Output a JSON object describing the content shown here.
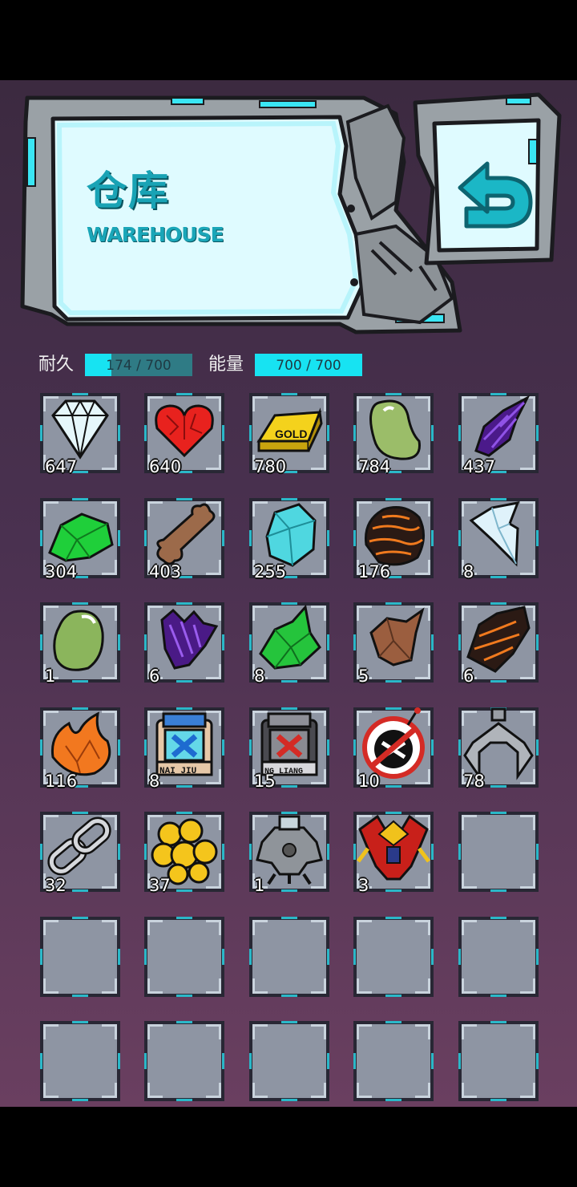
{
  "header": {
    "title_cn": "仓库",
    "title_en": "WAREHOUSE"
  },
  "stats": {
    "durability": {
      "label": "耐久",
      "text": "174 / 700",
      "current": 174,
      "max": 700
    },
    "energy": {
      "label": "能量",
      "text": "700 / 700",
      "current": 700,
      "max": 700
    }
  },
  "colors": {
    "panel_cyan": "#dffbff",
    "bar_fill": "#17e3f2",
    "bar_bg": "#2f7b85",
    "title": "#19a3b5"
  },
  "items": [
    {
      "icon": "diamond-icon",
      "count": "647"
    },
    {
      "icon": "red-heart-crystal-icon",
      "count": "640"
    },
    {
      "icon": "gold-bar-icon",
      "count": "780",
      "text": "GOLD"
    },
    {
      "icon": "green-bean-icon",
      "count": "784"
    },
    {
      "icon": "purple-crystal-shard-icon",
      "count": "437"
    },
    {
      "icon": "green-crystal-icon",
      "count": "304"
    },
    {
      "icon": "bone-icon",
      "count": "403"
    },
    {
      "icon": "cyan-crystal-icon",
      "count": "255"
    },
    {
      "icon": "lava-rock-icon",
      "count": "176"
    },
    {
      "icon": "ice-shard-icon",
      "count": "8"
    },
    {
      "icon": "green-blob-icon",
      "count": "1"
    },
    {
      "icon": "purple-spiky-crystal-icon",
      "count": "6"
    },
    {
      "icon": "green-gem-icon",
      "count": "8"
    },
    {
      "icon": "brown-rock-icon",
      "count": "5"
    },
    {
      "icon": "lava-shard-icon",
      "count": "6"
    },
    {
      "icon": "orange-flame-crystal-icon",
      "count": "116"
    },
    {
      "icon": "durability-canister-icon",
      "count": "8",
      "text": "NAI JIU"
    },
    {
      "icon": "energy-canister-icon",
      "count": "15",
      "text": "NG LIANG"
    },
    {
      "icon": "no-bomb-icon",
      "count": "10"
    },
    {
      "icon": "claw-icon",
      "count": "78"
    },
    {
      "icon": "chain-link-icon",
      "count": "32"
    },
    {
      "icon": "gold-coins-icon",
      "count": "37"
    },
    {
      "icon": "gray-mech-icon",
      "count": "1"
    },
    {
      "icon": "red-mech-icon",
      "count": "3"
    },
    {
      "icon": "",
      "count": ""
    },
    {
      "icon": "",
      "count": ""
    },
    {
      "icon": "",
      "count": ""
    },
    {
      "icon": "",
      "count": ""
    },
    {
      "icon": "",
      "count": ""
    },
    {
      "icon": "",
      "count": ""
    },
    {
      "icon": "",
      "count": ""
    },
    {
      "icon": "",
      "count": ""
    },
    {
      "icon": "",
      "count": ""
    },
    {
      "icon": "",
      "count": ""
    },
    {
      "icon": "",
      "count": ""
    }
  ]
}
